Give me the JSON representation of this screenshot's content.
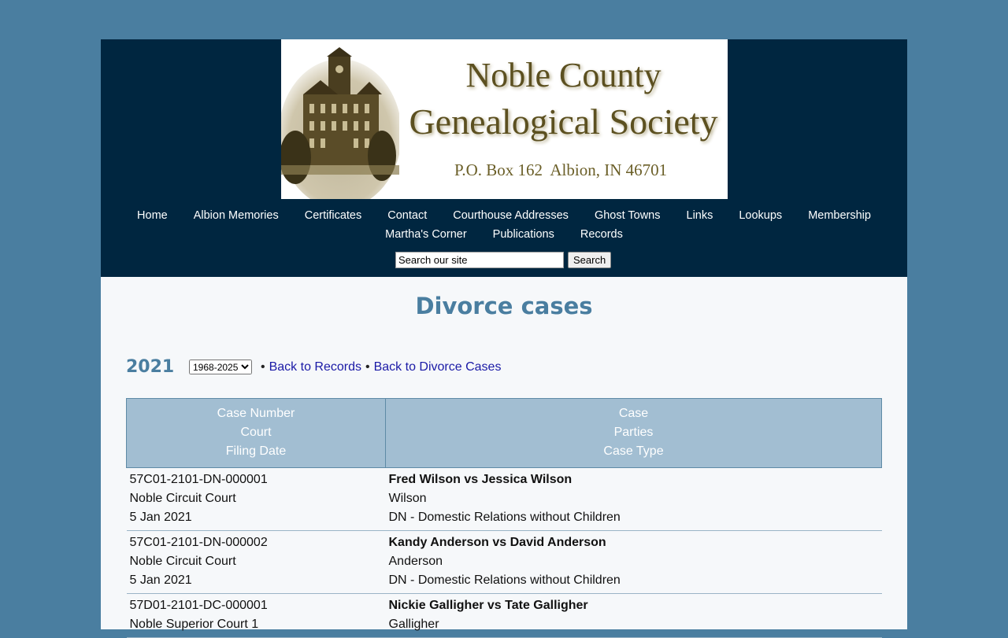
{
  "banner": {
    "title_line1": "Noble County",
    "title_line2": "Genealogical Society",
    "address": "P.O. Box 162  Albion, IN 46701"
  },
  "nav": {
    "row1": [
      "Home",
      "Albion Memories",
      "Certificates",
      "Contact",
      "Courthouse Addresses",
      "Ghost Towns",
      "Links",
      "Lookups",
      "Membership"
    ],
    "row2": [
      "Martha's Corner",
      "Publications",
      "Records"
    ]
  },
  "search": {
    "placeholder": "Search our site",
    "button_label": "Search"
  },
  "page_title": "Divorce cases",
  "filter": {
    "year": "2021",
    "range_selected": "1968-2025",
    "bullet": "•",
    "back_records": "Back to Records",
    "back_divorce": "Back to Divorce Cases"
  },
  "table": {
    "header_left": [
      "Case Number",
      "Court",
      "Filing Date"
    ],
    "header_right": [
      "Case",
      "Parties",
      "Case Type"
    ],
    "rows": [
      {
        "case_number": "57C01-2101-DN-000001",
        "court": "Noble Circuit Court",
        "date": "5 Jan 2021",
        "parties": "Fred Wilson vs Jessica Wilson",
        "case": "Wilson",
        "type": "DN - Domestic Relations without Children"
      },
      {
        "case_number": "57C01-2101-DN-000002",
        "court": "Noble Circuit Court",
        "date": "5 Jan 2021",
        "parties": "Kandy Anderson vs David Anderson",
        "case": "Anderson",
        "type": "DN - Domestic Relations without Children"
      },
      {
        "case_number": "57D01-2101-DC-000001",
        "court": "Noble Superior Court 1",
        "date": "",
        "parties": "Nickie Galligher vs Tate Galligher",
        "case": "Galligher",
        "type": ""
      }
    ]
  },
  "colors": {
    "background": "#4a7ea0",
    "header": "#002640",
    "accent": "#4a7ea0",
    "table_header": "#a2bed2",
    "link": "#1a1aa6"
  },
  "icons": [
    "courthouse-image"
  ]
}
